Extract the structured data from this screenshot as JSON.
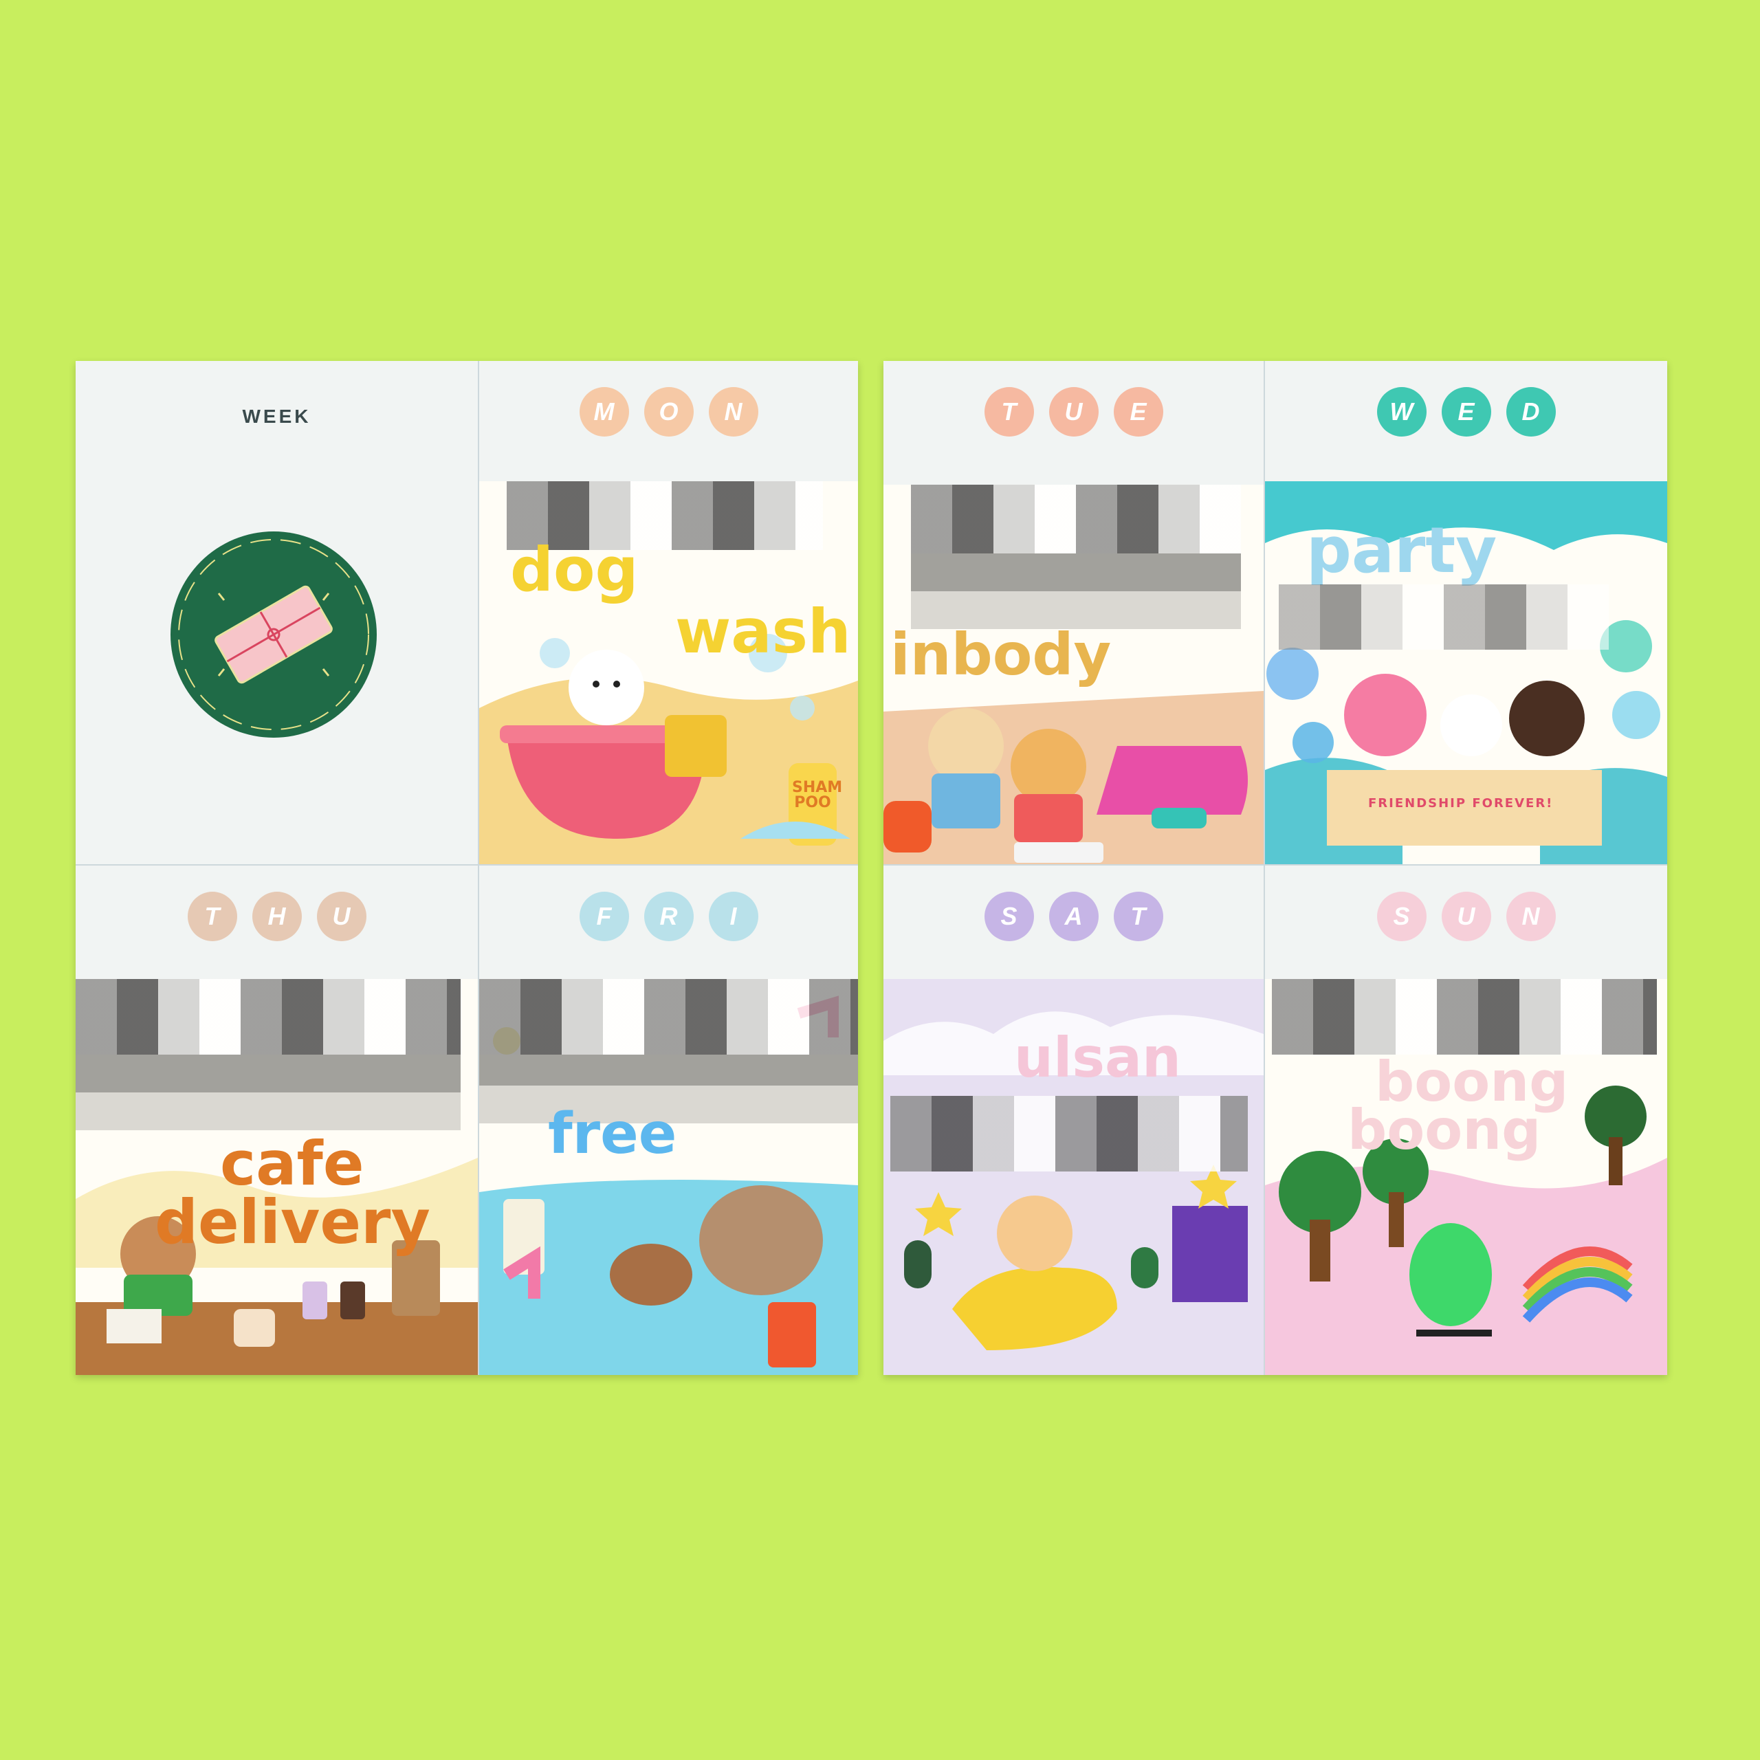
{
  "week_label": "WEEK",
  "days": [
    {
      "id": "mon",
      "letters": [
        "M",
        "O",
        "N"
      ],
      "dot_color": "#f6c9a6",
      "word": "dog",
      "word2": "wash",
      "word_color": "#f5d232"
    },
    {
      "id": "tue",
      "letters": [
        "T",
        "U",
        "E"
      ],
      "dot_color": "#f6b9a1",
      "word": "inbody",
      "word_color": "#e8b54f"
    },
    {
      "id": "wed",
      "letters": [
        "W",
        "E",
        "D"
      ],
      "dot_color": "#3fc8b2",
      "word": "party",
      "word_color": "#9ed7ee",
      "banner": "FRIENDSHIP FOREVER!"
    },
    {
      "id": "thu",
      "letters": [
        "T",
        "H",
        "U"
      ],
      "dot_color": "#e6c9b4",
      "word": "cafe",
      "word2": "delivery",
      "word_color": "#e07a25"
    },
    {
      "id": "fri",
      "letters": [
        "F",
        "R",
        "I"
      ],
      "dot_color": "#b9e1ea",
      "word": "free",
      "word_color": "#5cb7ee"
    },
    {
      "id": "sat",
      "letters": [
        "S",
        "A",
        "T"
      ],
      "dot_color": "#c6b5e6",
      "word": "ulsan",
      "word_color": "#f5c6d8"
    },
    {
      "id": "sun",
      "letters": [
        "S",
        "U",
        "N"
      ],
      "dot_color": "#f6cfd9",
      "word": "boong",
      "word2": "boong",
      "word_color": "#f7d3d8"
    }
  ],
  "stickers": {
    "shampoo": "SHAM POO"
  },
  "colors": {
    "background": "#c8ee5e",
    "paper": "#f1f4f3",
    "badge": "#1f6b47"
  }
}
